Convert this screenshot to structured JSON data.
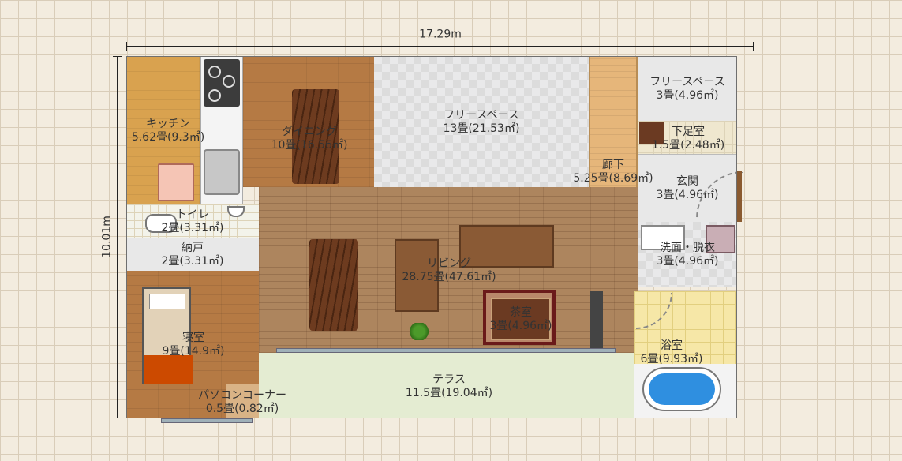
{
  "dimensions": {
    "width_label": "17.29m",
    "height_label": "10.01m"
  },
  "rooms": {
    "kitchen": {
      "name": "キッチン",
      "area": "5.62畳(9.3㎡)"
    },
    "dining": {
      "name": "ダイニング",
      "area": "10畳(16.56㎡)"
    },
    "free_space_main": {
      "name": "フリースペース",
      "area": "13畳(21.53㎡)"
    },
    "corridor": {
      "name": "廊下",
      "area": "5.25畳(8.69㎡)"
    },
    "free_space_small": {
      "name": "フリースペース",
      "area": "3畳(4.96㎡)"
    },
    "shoe_room": {
      "name": "下足室",
      "area": "1.5畳(2.48㎡)"
    },
    "entrance": {
      "name": "玄関",
      "area": "3畳(4.96㎡)"
    },
    "toilet": {
      "name": "トイレ",
      "area": "2畳(3.31㎡)"
    },
    "storage": {
      "name": "納戸",
      "area": "2畳(3.31㎡)"
    },
    "living": {
      "name": "リビング",
      "area": "28.75畳(47.61㎡)"
    },
    "washroom": {
      "name": "洗面・脱衣",
      "area": "3畳(4.96㎡)"
    },
    "bedroom": {
      "name": "寝室",
      "area": "9畳(14.9㎡)"
    },
    "tea_room": {
      "name": "茶室",
      "area": "3畳(4.96㎡)"
    },
    "bathroom": {
      "name": "浴室",
      "area": "6畳(9.93㎡)"
    },
    "terrace": {
      "name": "テラス",
      "area": "11.5畳(19.04㎡)"
    },
    "pc_corner": {
      "name": "パソコンコーナー",
      "area": "0.5畳(0.82㎡)"
    }
  },
  "colors": {
    "wall": "#6f6f6f",
    "bathtub": "#2f8fe0",
    "bed_cover": "#cc4a00",
    "tea_room": "#b9876a"
  }
}
